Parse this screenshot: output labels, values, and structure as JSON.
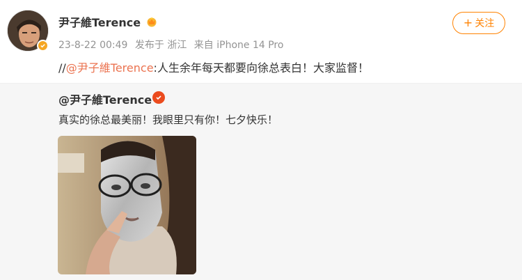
{
  "post": {
    "author": "尹子維Terence",
    "meta": {
      "time": "23-8-22 00:49",
      "location": "发布于 浙江",
      "device": "来自 iPhone 14 Pro"
    },
    "follow_label": "关注",
    "repost_prefix": "//",
    "repost_mention": "@尹子維Terence",
    "repost_body": ":人生余年每天都要向徐总表白！大家监督！"
  },
  "quoted": {
    "author": "@尹子維Terence",
    "text": "真实的徐总最美丽！我眼里只有你！七夕快乐！"
  },
  "colors": {
    "accent": "#ff8200",
    "mention": "#eb7350",
    "quoted_bg": "#f6f6f6",
    "meta_text": "#939393"
  },
  "icons": {
    "crown": "crown-icon",
    "verified": "verified-badge-icon",
    "plus": "plus-icon"
  }
}
